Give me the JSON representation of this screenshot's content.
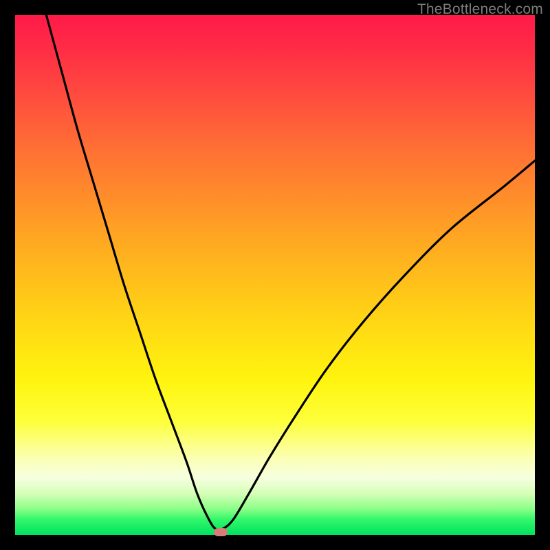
{
  "watermark": "TheBottleneck.com",
  "chart_data": {
    "type": "line",
    "title": "",
    "xlabel": "",
    "ylabel": "",
    "xlim": [
      0,
      100
    ],
    "ylim": [
      0,
      100
    ],
    "marker": {
      "x": 39.5,
      "y": 0.5,
      "color": "#d67d7a"
    },
    "series": [
      {
        "name": "bottleneck-curve",
        "x": [
          6,
          9,
          12,
          15,
          18,
          21,
          24,
          27,
          30,
          33,
          35,
          37,
          38.5,
          40,
          42,
          45,
          49,
          54,
          60,
          67,
          75,
          84,
          94,
          100
        ],
        "values": [
          100,
          89,
          78,
          68,
          58,
          48,
          39,
          30,
          22,
          14,
          8,
          3.5,
          1.2,
          1.2,
          3,
          8,
          15,
          23,
          32,
          41,
          50,
          59,
          67,
          72
        ]
      }
    ],
    "background_gradient": {
      "top": "#ff1a49",
      "mid": "#fff40e",
      "bottom": "#00e25e"
    }
  }
}
